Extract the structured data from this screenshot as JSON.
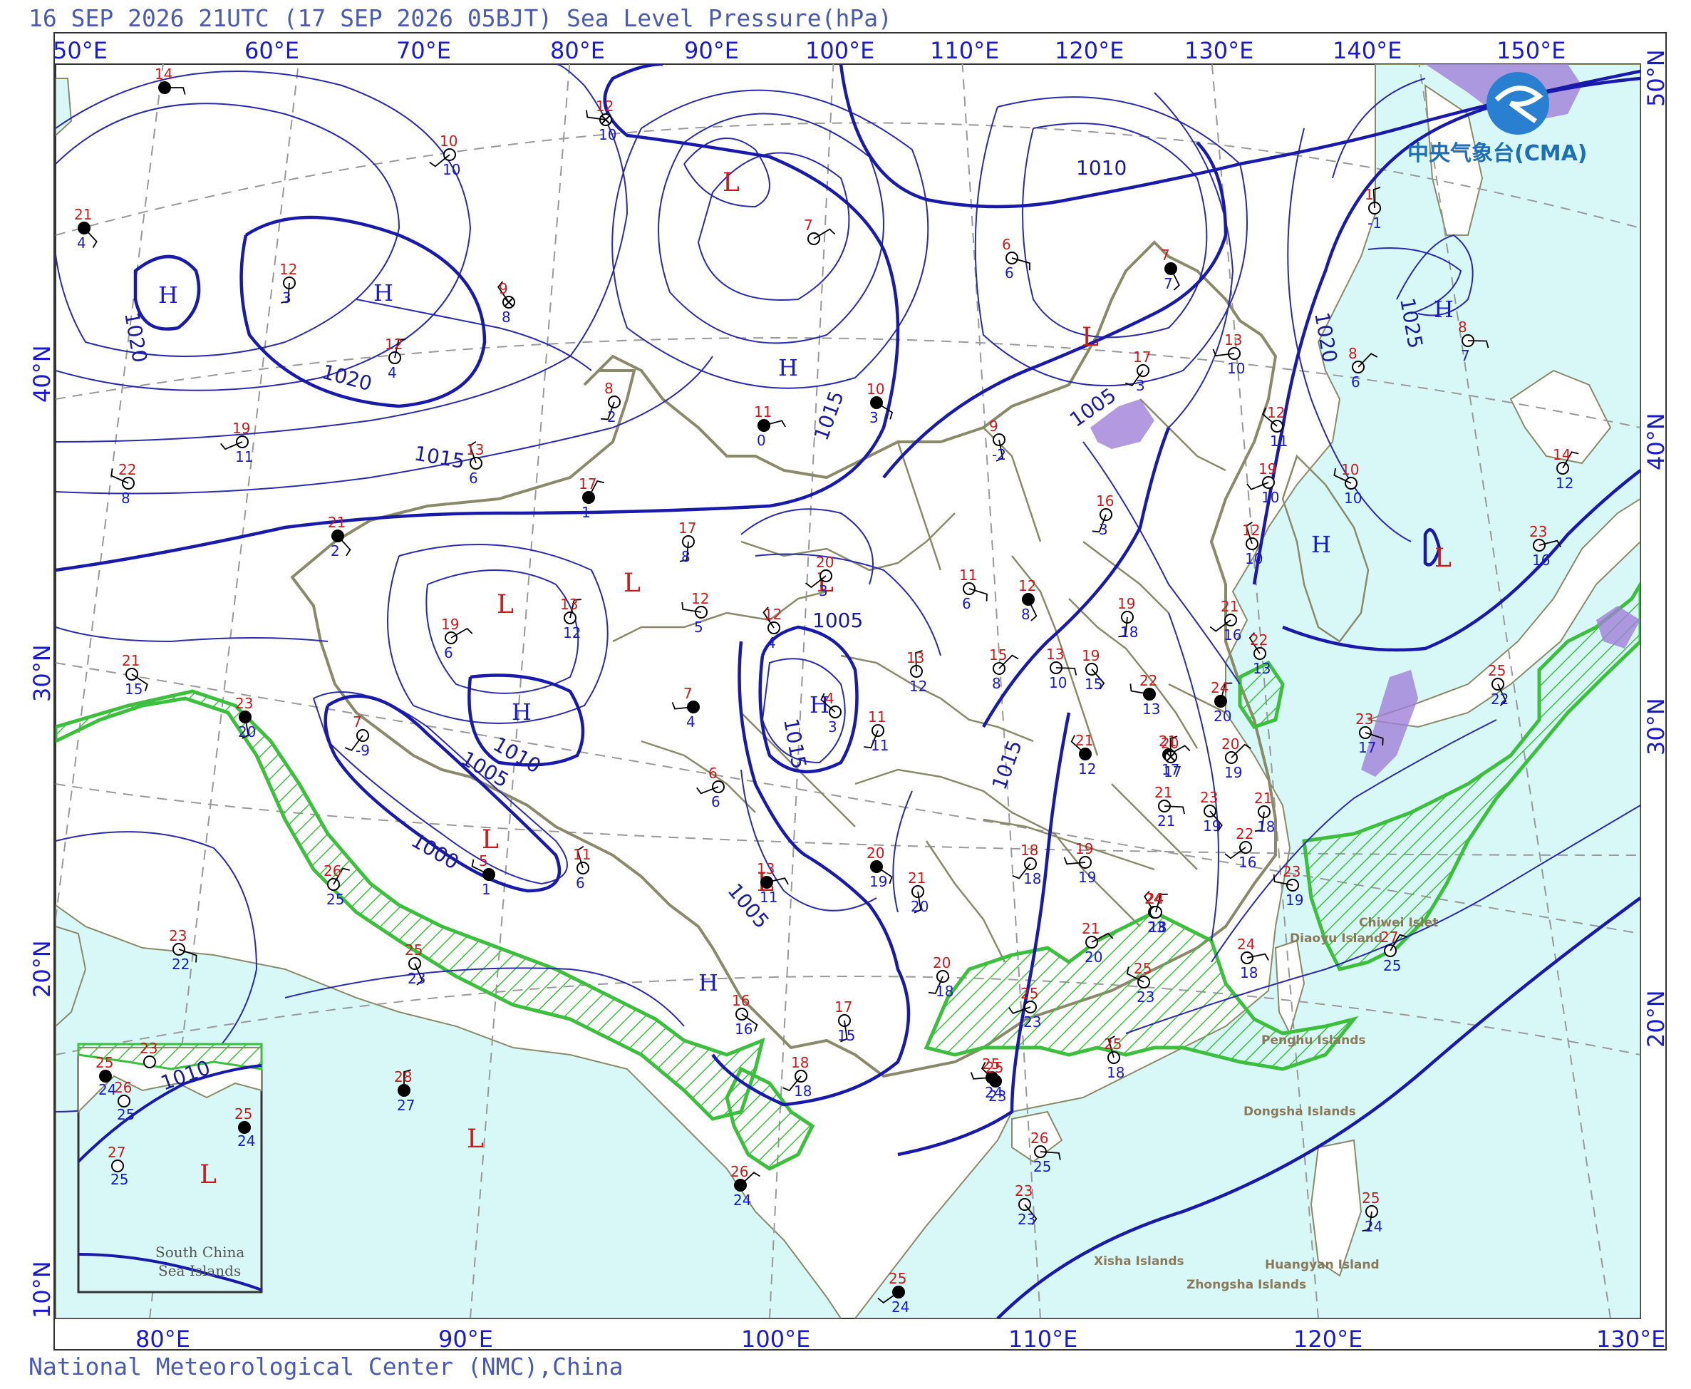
{
  "header": {
    "title": "16 SEP 2026 21UTC (17 SEP 2026 05BJT) Sea Level Pressure(hPa)"
  },
  "footer": {
    "credit": "National Meteorological Center (NMC),China"
  },
  "logo": {
    "text": "中央气象台(CMA)",
    "icon": "cma-logo-icon"
  },
  "axes": {
    "top_lon": [
      "50°E",
      "60°E",
      "70°E",
      "80°E",
      "90°E",
      "100°E",
      "110°E",
      "120°E",
      "130°E",
      "140°E",
      "150°E"
    ],
    "bottom_lon": [
      "80°E",
      "90°E",
      "100°E",
      "110°E",
      "120°E",
      "130°E"
    ],
    "left_lat": [
      "40°N",
      "30°N",
      "20°N",
      "10°N"
    ],
    "right_lat": [
      "50°N",
      "40°N",
      "30°N",
      "20°N"
    ]
  },
  "isobars": {
    "labels": [
      "1020",
      "1020",
      "1010",
      "1015",
      "1015",
      "1010",
      "1005",
      "1000",
      "1005",
      "1015",
      "1005",
      "1005",
      "1015",
      "1020",
      "1025",
      "1010"
    ]
  },
  "centers": {
    "H": [
      "H",
      "H",
      "H",
      "H",
      "H",
      "H",
      "H",
      "H"
    ],
    "L": [
      "L",
      "L",
      "L",
      "L",
      "L",
      "L",
      "L",
      "L",
      "L"
    ]
  },
  "stations": [
    {
      "t": "14",
      "td": ""
    },
    {
      "t": "21",
      "td": "4"
    },
    {
      "t": "12",
      "td": "3"
    },
    {
      "t": "10",
      "td": "10"
    },
    {
      "t": "12",
      "td": "10"
    },
    {
      "t": "9",
      "td": "8"
    },
    {
      "t": "12",
      "td": "4"
    },
    {
      "t": "7",
      "td": ""
    },
    {
      "t": "6",
      "td": "6"
    },
    {
      "t": "7",
      "td": "7"
    },
    {
      "t": "8",
      "td": "2"
    },
    {
      "t": "19",
      "td": "11"
    },
    {
      "t": "22",
      "td": "8"
    },
    {
      "t": "13",
      "td": "6"
    },
    {
      "t": "17",
      "td": "1"
    },
    {
      "t": "11",
      "td": "0"
    },
    {
      "t": "10",
      "td": "3"
    },
    {
      "t": "9",
      "td": "-2"
    },
    {
      "t": "17",
      "td": "3"
    },
    {
      "t": "13",
      "td": "10"
    },
    {
      "t": "12",
      "td": "11"
    },
    {
      "t": "1",
      "td": "-1"
    },
    {
      "t": "8",
      "td": "6"
    },
    {
      "t": "8",
      "td": "7"
    },
    {
      "t": "21",
      "td": "2"
    },
    {
      "t": "17",
      "td": "8"
    },
    {
      "t": "20",
      "td": "3"
    },
    {
      "t": "12",
      "td": "5"
    },
    {
      "t": "12",
      "td": "4"
    },
    {
      "t": "13",
      "td": "12"
    },
    {
      "t": "19",
      "td": "6"
    },
    {
      "t": "11",
      "td": "6"
    },
    {
      "t": "12",
      "td": "8"
    },
    {
      "t": "16",
      "td": "3"
    },
    {
      "t": "19",
      "td": "10"
    },
    {
      "t": "10",
      "td": "10"
    },
    {
      "t": "12",
      "td": "10"
    },
    {
      "t": "14",
      "td": "12"
    },
    {
      "t": "23",
      "td": "16"
    },
    {
      "t": "21",
      "td": "15"
    },
    {
      "t": "23",
      "td": "20"
    },
    {
      "t": "7",
      "td": "-9"
    },
    {
      "t": "7",
      "td": "4"
    },
    {
      "t": "4",
      "td": "3"
    },
    {
      "t": "13",
      "td": "12"
    },
    {
      "t": "15",
      "td": "8"
    },
    {
      "t": "13",
      "td": "10"
    },
    {
      "t": "19",
      "td": "15"
    },
    {
      "t": "19",
      "td": "18"
    },
    {
      "t": "21",
      "td": "16"
    },
    {
      "t": "22",
      "td": "13"
    },
    {
      "t": "22",
      "td": "13"
    },
    {
      "t": "24",
      "td": "20"
    },
    {
      "t": "21",
      "td": "17"
    },
    {
      "t": "23",
      "td": "17"
    },
    {
      "t": "25",
      "td": "22"
    },
    {
      "t": "11",
      "td": "11"
    },
    {
      "t": "6",
      "td": "6"
    },
    {
      "t": "5",
      "td": "1"
    },
    {
      "t": "11",
      "td": "6"
    },
    {
      "t": "26",
      "td": "25"
    },
    {
      "t": "13",
      "td": "11"
    },
    {
      "t": "20",
      "td": "19"
    },
    {
      "t": "21",
      "td": "20"
    },
    {
      "t": "18",
      "td": "18"
    },
    {
      "t": "19",
      "td": "19"
    },
    {
      "t": "21",
      "td": "12"
    },
    {
      "t": "20",
      "td": "17"
    },
    {
      "t": "20",
      "td": "19"
    },
    {
      "t": "21",
      "td": "21"
    },
    {
      "t": "23",
      "td": "19"
    },
    {
      "t": "21",
      "td": "18"
    },
    {
      "t": "22",
      "td": "16"
    },
    {
      "t": "23",
      "td": "19"
    },
    {
      "t": "24",
      "td": "23"
    },
    {
      "t": "24",
      "td": "18"
    },
    {
      "t": "21",
      "td": "20"
    },
    {
      "t": "23",
      "td": "22"
    },
    {
      "t": "25",
      "td": "23"
    },
    {
      "t": "20",
      "td": "18"
    },
    {
      "t": "25",
      "td": "23"
    },
    {
      "t": "25",
      "td": "23"
    },
    {
      "t": "25",
      "td": "18"
    },
    {
      "t": "27",
      "td": "25"
    },
    {
      "t": "24",
      "td": "18"
    },
    {
      "t": "16",
      "td": "16"
    },
    {
      "t": "17",
      "td": "15"
    },
    {
      "t": "18",
      "td": "18"
    },
    {
      "t": "25",
      "td": "24"
    },
    {
      "t": "25",
      "td": "23"
    },
    {
      "t": "28",
      "td": "27"
    },
    {
      "t": "26",
      "td": "24"
    },
    {
      "t": "26",
      "td": "25"
    },
    {
      "t": "23",
      "td": "23"
    },
    {
      "t": "25",
      "td": "24"
    },
    {
      "t": "25",
      "td": "24"
    }
  ],
  "places": [
    "Chiwei Islet",
    "Diaoyu Island",
    "Penghu Islands",
    "Dongsha Islands",
    "Xisha Islands",
    "Huangyan Island",
    "Zhongsha Islands"
  ],
  "inset": {
    "title_line1": "South China",
    "title_line2": "Sea Islands",
    "isobar": "1010",
    "center": "L",
    "stations": [
      {
        "t": "25",
        "td": "24"
      },
      {
        "t": "26",
        "td": "25"
      },
      {
        "t": "25",
        "td": "24"
      },
      {
        "t": "27",
        "td": "25"
      },
      {
        "t": "23",
        "td": ""
      }
    ]
  }
}
